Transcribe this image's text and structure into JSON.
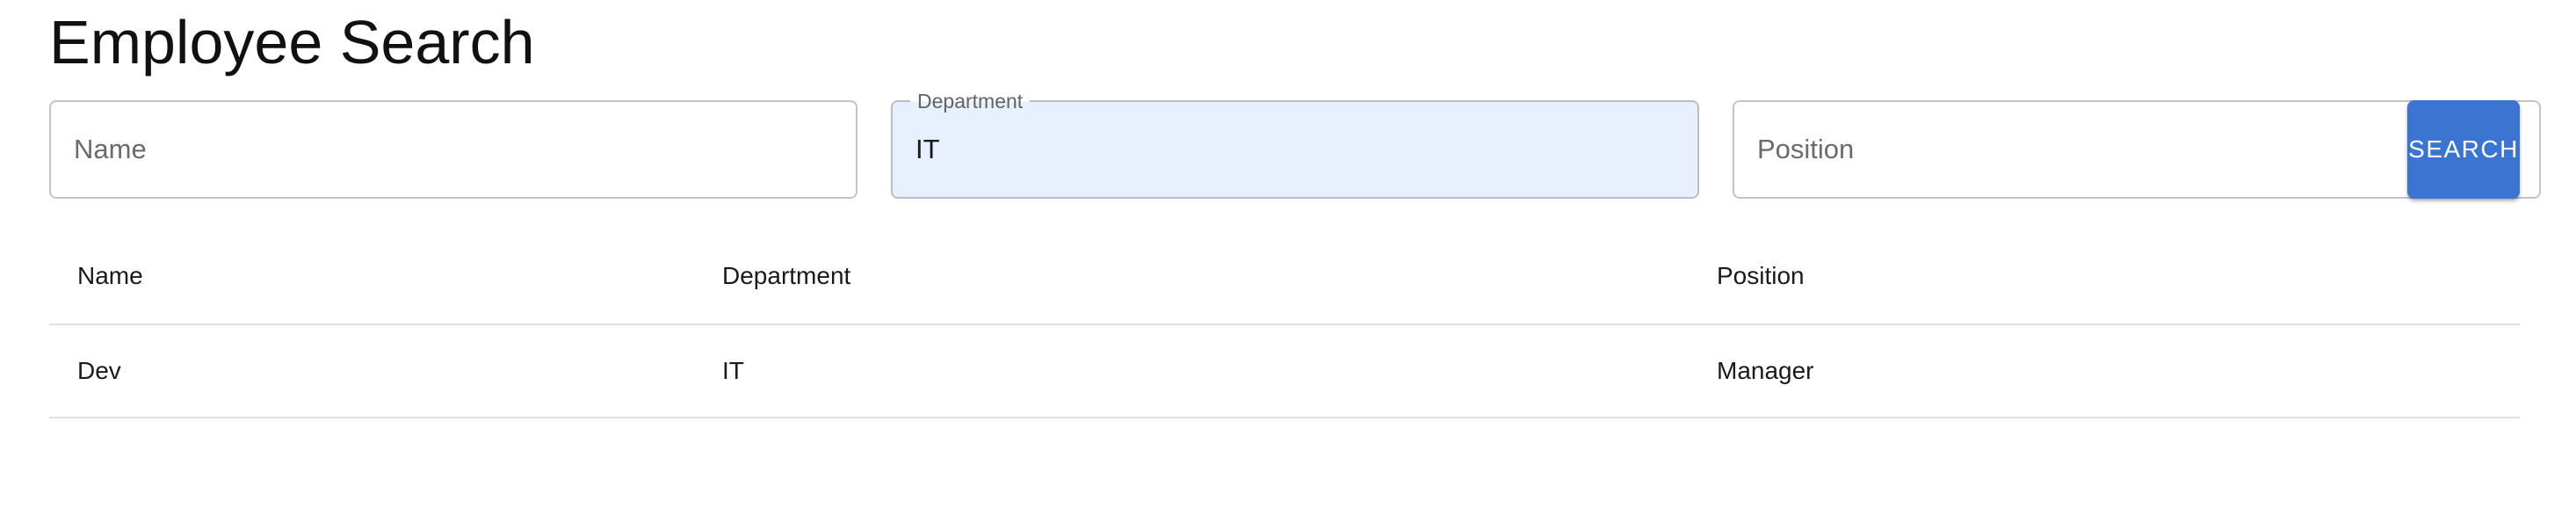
{
  "page": {
    "title": "Employee Search"
  },
  "search_form": {
    "name_field": {
      "placeholder": "Name",
      "value": ""
    },
    "department_field": {
      "label": "Department",
      "value": "IT"
    },
    "position_field": {
      "placeholder": "Position",
      "value": ""
    },
    "search_button_label": "SEARCH"
  },
  "results_table": {
    "columns": [
      "Name",
      "Department",
      "Position"
    ],
    "rows": [
      [
        "Dev",
        "IT",
        "Manager"
      ]
    ]
  },
  "colors": {
    "accent": "#3b74d1",
    "filled_field_background": "#e8f0fe"
  }
}
